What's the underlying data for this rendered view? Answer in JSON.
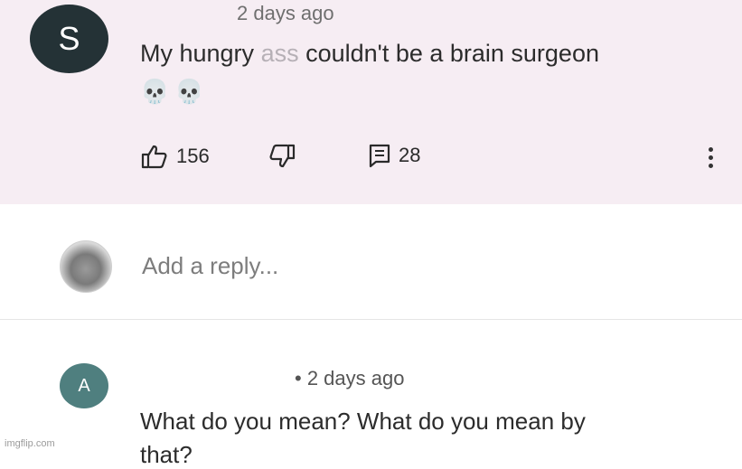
{
  "comment": {
    "avatar_letter": "S",
    "timestamp": "2 days ago",
    "text_start": "My hungry ",
    "text_faded": "ass",
    "text_end": " couldn't be a brain surgeon",
    "emojis": "💀💀",
    "likes": "156",
    "replies": "28"
  },
  "reply_box": {
    "placeholder": "Add a reply..."
  },
  "reply": {
    "avatar_letter": "A",
    "timestamp": "• 2 days ago",
    "text": "What do you mean? What do you mean by",
    "text_cont": "that?"
  },
  "watermark": "imgflip.com",
  "colors": {
    "comment_bg": "#f6edf3",
    "avatar_s": "#243236",
    "avatar_a": "#4f7f7f"
  }
}
